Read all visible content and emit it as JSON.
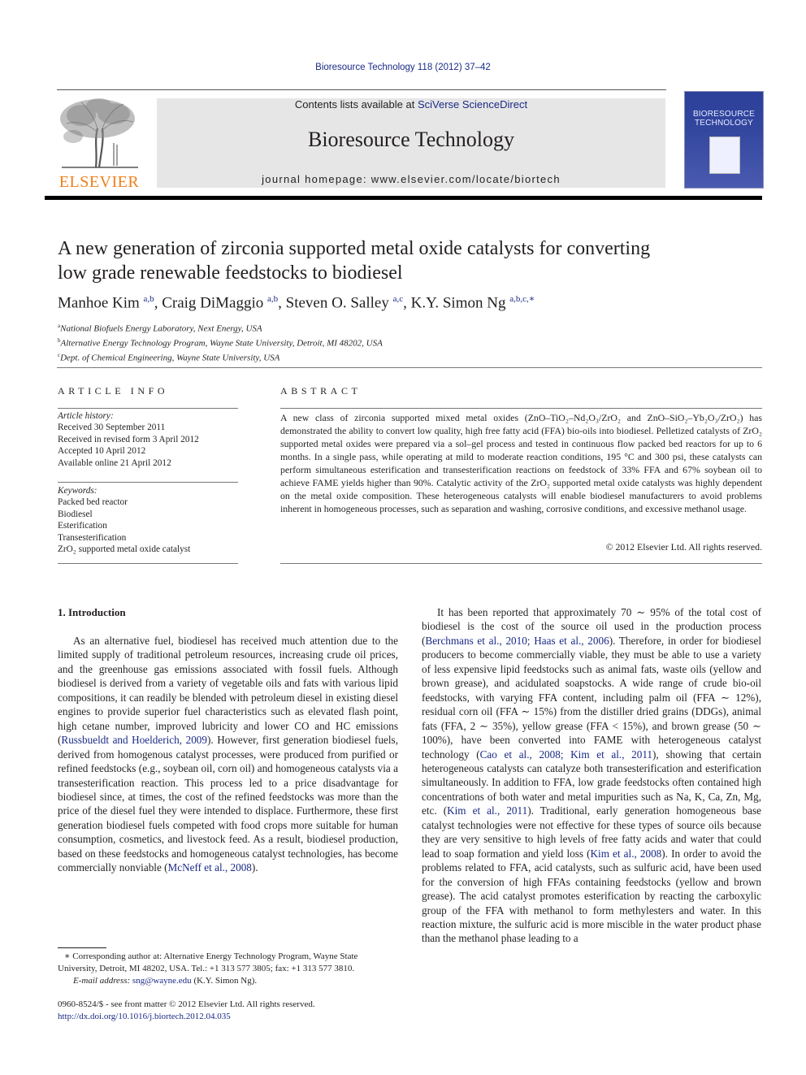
{
  "header": {
    "journal_ref": "Bioresource Technology 118 (2012) 37–42",
    "contents_prefix": "Contents lists available at ",
    "contents_link": "SciVerse ScienceDirect",
    "journal_title": "Bioresource Technology",
    "homepage": "journal homepage: www.elsevier.com/locate/biortech",
    "publisher_logo": "ELSEVIER",
    "cover_title_line1": "BIORESOURCE",
    "cover_title_line2": "TECHNOLOGY",
    "brand_color": "#f07f1a",
    "link_color": "#1a2a86"
  },
  "article": {
    "title_line1": "A new generation of zirconia supported metal oxide catalysts for converting",
    "title_line2": "low grade renewable feedstocks to biodiesel",
    "authors": [
      {
        "name": "Manhoe Kim",
        "sup": "a,b"
      },
      {
        "name": "Craig DiMaggio",
        "sup": "a,b"
      },
      {
        "name": "Steven O. Salley",
        "sup": "a,c"
      },
      {
        "name": "K.Y. Simon Ng",
        "sup": "a,b,c,∗"
      }
    ],
    "affiliations": [
      {
        "key": "a",
        "text": "National Biofuels Energy Laboratory, Next Energy, USA"
      },
      {
        "key": "b",
        "text": "Alternative Energy Technology Program, Wayne State University, Detroit, MI 48202, USA"
      },
      {
        "key": "c",
        "text": "Dept. of Chemical Engineering, Wayne State University, USA"
      }
    ]
  },
  "article_info": {
    "heading": "ARTICLE INFO",
    "history_label": "Article history:",
    "history": [
      "Received 30 September 2011",
      "Received in revised form 3 April 2012",
      "Accepted 10 April 2012",
      "Available online 21 April 2012"
    ],
    "keywords_label": "Keywords:",
    "keywords": [
      "Packed bed reactor",
      "Biodiesel",
      "Esterification",
      "Transesterification",
      "ZrO₂ supported metal oxide catalyst"
    ]
  },
  "abstract": {
    "heading": "ABSTRACT",
    "text": "A new class of zirconia supported mixed metal oxides (ZnO–TiO₂–Nd₂O₃/ZrO₂ and ZnO–SiO₂–Yb₂O₃/ZrO₂) has demonstrated the ability to convert low quality, high free fatty acid (FFA) bio-oils into biodiesel. Pelletized catalysts of ZrO₂ supported metal oxides were prepared via a sol–gel process and tested in continuous flow packed bed reactors for up to 6 months. In a single pass, while operating at mild to moderate reaction conditions, 195 °C and 300 psi, these catalysts can perform simultaneous esterification and transesterification reactions on feedstock of 33% FFA and 67% soybean oil to achieve FAME yields higher than 90%. Catalytic activity of the ZrO₂ supported metal oxide catalysts was highly dependent on the metal oxide composition. These heterogeneous catalysts will enable biodiesel manufacturers to avoid problems inherent in homogeneous processes, such as separation and washing, corrosive conditions, and excessive methanol usage.",
    "copyright": "© 2012 Elsevier Ltd. All rights reserved."
  },
  "intro": {
    "heading": "1. Introduction",
    "left": {
      "p1": "As an alternative fuel, biodiesel has received much attention due to the limited supply of traditional petroleum resources, increasing crude oil prices, and the greenhouse gas emissions associated with fossil fuels. Although biodiesel is derived from a variety of vegetable oils and fats with various lipid compositions, it can readily be blended with petroleum diesel in existing diesel engines to provide superior fuel characteristics such as elevated flash point, high cetane number, improved lubricity and lower CO and HC emissions (",
      "ref1": "Russbueldt and Hoelderich, 2009",
      "p2": "). However, first generation biodiesel fuels, derived from homogenous catalyst processes, were produced from purified or refined feedstocks (e.g., soybean oil, corn oil) and homogeneous catalysts via a transesterification reaction. This process led to a price disadvantage for biodiesel since, at times, the cost of the refined feedstocks was more than the price of the diesel fuel they were intended to displace. Furthermore, these first generation biodiesel fuels competed with food crops more suitable for human consumption, cosmetics, and livestock feed. As a result, biodiesel production, based on these feedstocks and homogeneous catalyst technologies, has become commercially nonviable (",
      "ref2": "McNeff et al., 2008",
      "p3": ")."
    },
    "right": {
      "p1": "It has been reported that approximately 70 ∼ 95% of the total cost of biodiesel is the cost of the source oil used in the production process (",
      "ref1": "Berchmans et al., 2010; Haas et al., 2006",
      "p2": "). Therefore, in order for biodiesel producers to become commercially viable, they must be able to use a variety of less expensive lipid feedstocks such as animal fats, waste oils (yellow and brown grease), and acidulated soapstocks. A wide range of crude bio-oil feedstocks, with varying FFA content, including palm oil (FFA ∼ 12%), residual corn oil (FFA ∼ 15%) from the distiller dried grains (DDGs), animal fats (FFA, 2 ∼ 35%), yellow grease (FFA < 15%), and brown grease (50 ∼ 100%), have been converted into FAME with heterogeneous catalyst technology (",
      "ref2": "Cao et al., 2008; Kim et al., 2011",
      "p3": "), showing that certain heterogeneous catalysts can catalyze both transesterification and esterification simultaneously. In addition to FFA, low grade feedstocks often contained high concentrations of both water and metal impurities such as Na, K, Ca, Zn, Mg, etc. (",
      "ref3": "Kim et al., 2011",
      "p4": "). Traditional, early generation homogeneous base catalyst technologies were not effective for these types of source oils because they are very sensitive to high levels of free fatty acids and water that could lead to soap formation and yield loss (",
      "ref4": "Kim et al., 2008",
      "p5": "). In order to avoid the problems related to FFA, acid catalysts, such as sulfuric acid, have been used for the conversion of high FFAs containing feedstocks (yellow and brown grease). The acid catalyst promotes esterification by reacting the carboxylic group of the FFA with methanol to form methylesters and water. In this reaction mixture, the sulfuric acid is more miscible in the water product phase than the methanol phase leading to a"
    }
  },
  "footnote": {
    "star": "∗",
    "corresponding": " Corresponding author at: Alternative Energy Technology Program, Wayne State University, Detroit, MI 48202, USA. Tel.: +1 313 577 3805; fax: +1 313 577 3810.",
    "email_label": "E-mail address: ",
    "email": "sng@wayne.edu",
    "email_suffix": " (K.Y. Simon Ng).",
    "issn": "0960-8524/$ - see front matter © 2012 Elsevier Ltd. All rights reserved.",
    "doi": "http://dx.doi.org/10.1016/j.biortech.2012.04.035"
  }
}
